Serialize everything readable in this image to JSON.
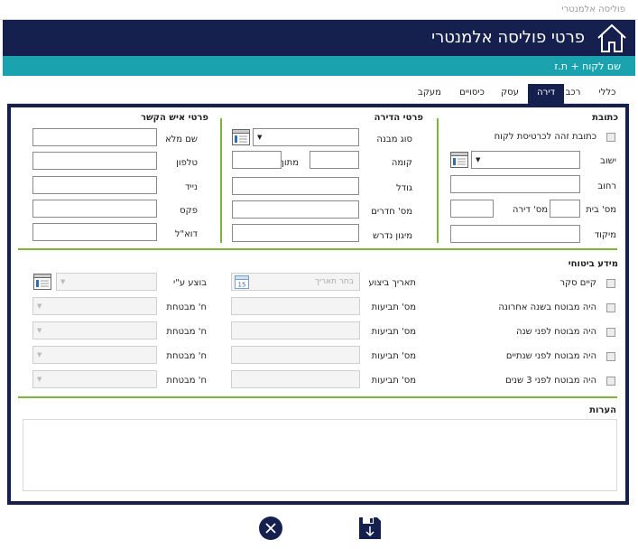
{
  "window": {
    "title": "פוליסה אלמנטרי"
  },
  "header": {
    "title": "פרטי פוליסה אלמנטרי"
  },
  "subbar": {
    "text": "שם לקוח + ת.ז"
  },
  "tabs": [
    "כללי",
    "רכב",
    "דירה",
    "עסק",
    "כיסויים",
    "מעקב"
  ],
  "address": {
    "section": "כתובת",
    "same_address": "כתובת זהה לכרטיסת לקוח",
    "settlement": "ישוב",
    "street": "רחוב",
    "house_no": "מס' בית",
    "apt_no": "מס' דירה",
    "zip": "מיקוד"
  },
  "apartment": {
    "section": "פרטי הדירה",
    "building_type": "סוג מבנה",
    "floor": "קומה",
    "of_total": "מתוך",
    "size": "גודל",
    "rooms": "מס' חדרים",
    "protection": "מיגון נדרש"
  },
  "contact": {
    "section": "פרטי איש הקשר",
    "full_name": "שם מלא",
    "phone": "טלפון",
    "mobile": "נייד",
    "fax": "פקס",
    "email": "דוא\"ל"
  },
  "insurance": {
    "section": "מידע ביטוחי",
    "survey": "קיים סקר",
    "last_year": "היה מבוטח בשנה אחרונה",
    "year_ago": "היה מבוטח לפני שנה",
    "two_years": "היה מבוטח לפני שנתיים",
    "three_years": "היה מבוטח לפני 3 שנים",
    "exec_date": "תאריך ביצוע",
    "date_placeholder": "בחר תאריך",
    "claims": "מס' תביעות",
    "done_by": "בוצע ע\"י",
    "insurer": "ח' מבטחת"
  },
  "notes": {
    "section": "הערות"
  },
  "icons": {
    "home": "home-icon",
    "calendar": "calendar-icon",
    "list": "list-icon",
    "cancel": "cancel-icon",
    "save": "save-icon"
  },
  "colors": {
    "navy": "#15204f",
    "teal": "#1aa3ae",
    "green": "#7db43a"
  }
}
